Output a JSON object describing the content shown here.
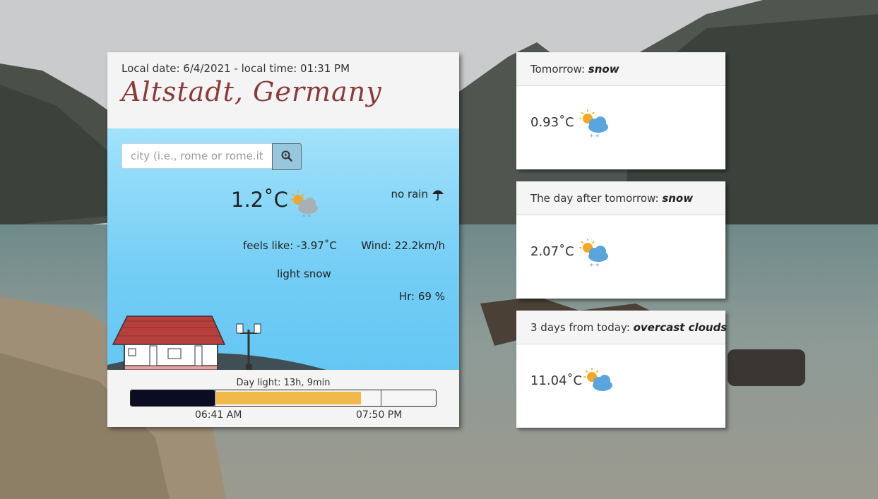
{
  "current": {
    "local_datetime": "Local date: 6/4/2021 - local time: 01:31 PM",
    "city": "Altstadt, Germany",
    "search_placeholder": "city (i.e., rome or rome.it)",
    "temperature": "1.2˚C",
    "rain": "no rain",
    "feels_like": "feels like: -3.97˚C",
    "wind": "Wind: 22.2km/h",
    "description": "light snow",
    "humidity": "Hr: 69 %",
    "icon": "partly-cloudy-snow-icon"
  },
  "daylight": {
    "label": "Day light: 13h, 9min",
    "sunrise": "06:41 AM",
    "sunset": "07:50 PM",
    "progress_fraction": 0.38,
    "night_fraction": 0.275,
    "sunset_fraction": 0.82
  },
  "forecast": [
    {
      "day_label": "Tomorrow:",
      "condition": "snow",
      "temperature": "0.93˚C",
      "icon": "sun-cloud-snow-icon"
    },
    {
      "day_label": "The day after tomorrow:",
      "condition": "snow",
      "temperature": "2.07˚C",
      "icon": "sun-cloud-snow-icon"
    },
    {
      "day_label": "3 days from today:",
      "condition": "overcast clouds",
      "temperature": "11.04˚C",
      "icon": "sun-cloud-icon"
    }
  ],
  "colors": {
    "city_title": "#8a3b3a",
    "sky": "#73cdf5",
    "night_bar": "#0b0b22",
    "sun_bar": "#f1b94a",
    "icon_cloud": "#5aa5de",
    "icon_sun": "#f5a623"
  }
}
